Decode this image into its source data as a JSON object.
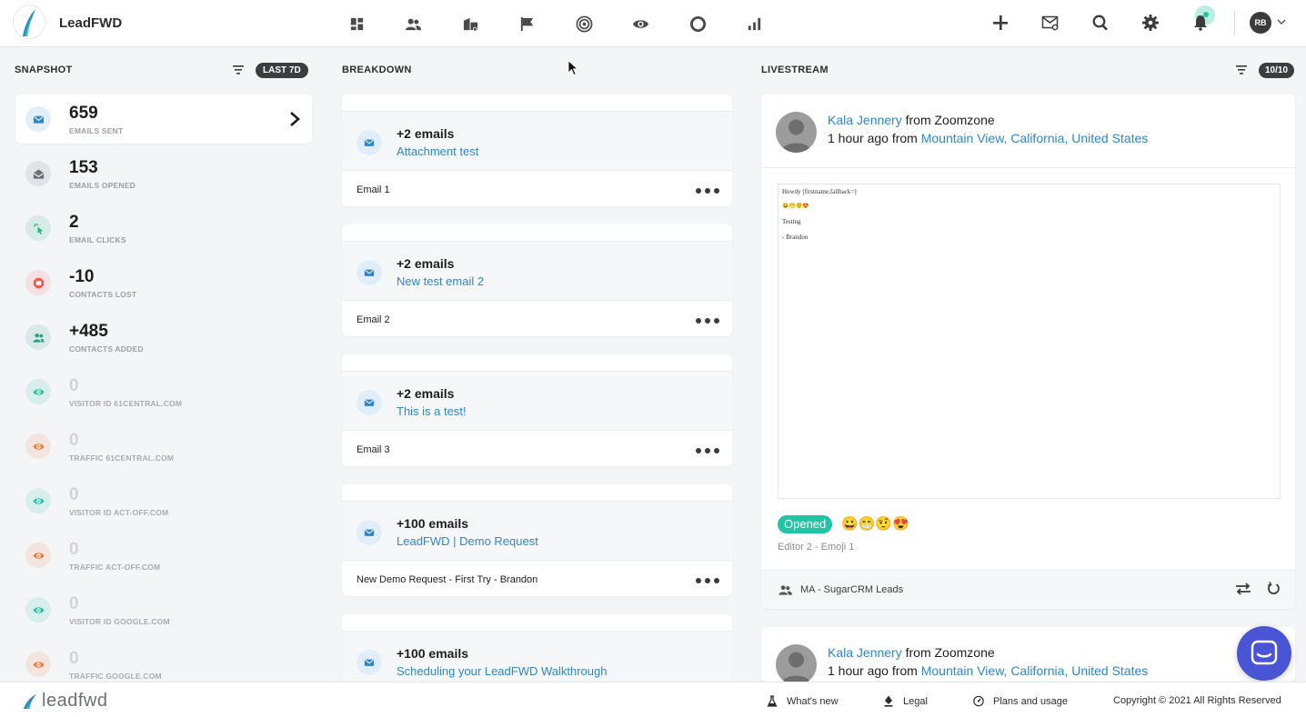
{
  "app": {
    "name": "LeadFWD"
  },
  "header": {
    "nav_icons": [
      "dashboard-icon",
      "contacts-icon",
      "companies-icon",
      "campaigns-flag-icon",
      "target-icon",
      "visitors-eye-icon",
      "circle-icon",
      "reports-icon"
    ],
    "tools": [
      "plus-icon",
      "mail-search-icon",
      "search-icon",
      "settings-icon",
      "bell-icon"
    ],
    "user_initials": "RB"
  },
  "snapshot": {
    "title": "SNAPSHOT",
    "range": "LAST 7D",
    "items": [
      {
        "value": "659",
        "label": "EMAILS SENT",
        "icon": "mail-icon",
        "color": "#2f86c9"
      },
      {
        "value": "153",
        "label": "EMAILS OPENED",
        "icon": "mail-open-icon",
        "color": "#6b6f76"
      },
      {
        "value": "2",
        "label": "EMAIL CLICKS",
        "icon": "click-icon",
        "color": "#21b57b"
      },
      {
        "value": "-10",
        "label": "CONTACTS LOST",
        "icon": "stop-icon",
        "color": "#ef5a4a"
      },
      {
        "value": "+485",
        "label": "CONTACTS ADDED",
        "icon": "contacts-icon",
        "color": "#2aa08a"
      },
      {
        "value": "0",
        "label": "VISITOR ID 61CENTRAL.COM",
        "icon": "eye-icon",
        "color": "#21c4a4"
      },
      {
        "value": "0",
        "label": "TRAFFIC 61CENTRAL.COM",
        "icon": "eye-icon",
        "color": "#f07a3a"
      },
      {
        "value": "0",
        "label": "VISITOR ID ACT-OFF.COM",
        "icon": "eye-icon",
        "color": "#21c4a4"
      },
      {
        "value": "0",
        "label": "TRAFFIC ACT-OFF.COM",
        "icon": "eye-icon",
        "color": "#f07a3a"
      },
      {
        "value": "0",
        "label": "VISITOR ID GOOGLE.COM",
        "icon": "eye-icon",
        "color": "#21c4a4"
      },
      {
        "value": "0",
        "label": "TRAFFIC GOOGLE.COM",
        "icon": "eye-icon",
        "color": "#f07a3a"
      }
    ]
  },
  "breakdown": {
    "title": "BREAKDOWN",
    "cards": [
      {
        "count": "+2 emails",
        "subject": "Attachment test",
        "name": "Email 1"
      },
      {
        "count": "+2 emails",
        "subject": "New test email 2",
        "name": "Email 2"
      },
      {
        "count": "+2 emails",
        "subject": "This is a test!",
        "name": "Email 3"
      },
      {
        "count": "+100 emails",
        "subject": "LeadFWD | Demo Request",
        "name": "New Demo Request - First Try - Brandon"
      },
      {
        "count": "+100 emails",
        "subject": "Scheduling your LeadFWD Walkthrough",
        "name": ""
      }
    ]
  },
  "livestream": {
    "title": "LIVESTREAM",
    "count": "10/10",
    "events": [
      {
        "person": "Kala Jennery",
        "from_word": "from",
        "company": "Zoomzone",
        "time": "1 hour ago",
        "location": "Mountain View, California, United States",
        "preview_lines": [
          "Howdy [firstname,fallback=]",
          "😀😁🤨😍",
          "Testing",
          "- Brandon"
        ],
        "status": "Opened",
        "emojis": "😀😁🤨😍",
        "editor_note": "Editor 2 - Emoji 1",
        "list_name": "MA - SugarCRM Leads"
      },
      {
        "person": "Kala Jennery",
        "from_word": "from",
        "company": "Zoomzone",
        "time": "1 hour ago",
        "location": "Mountain View, California, United States"
      }
    ]
  },
  "footer": {
    "logo_text": "leadfwd",
    "links": [
      "What's new",
      "Legal",
      "Plans and usage"
    ],
    "copyright": "Copyright © 2021 All Rights Reserved"
  }
}
